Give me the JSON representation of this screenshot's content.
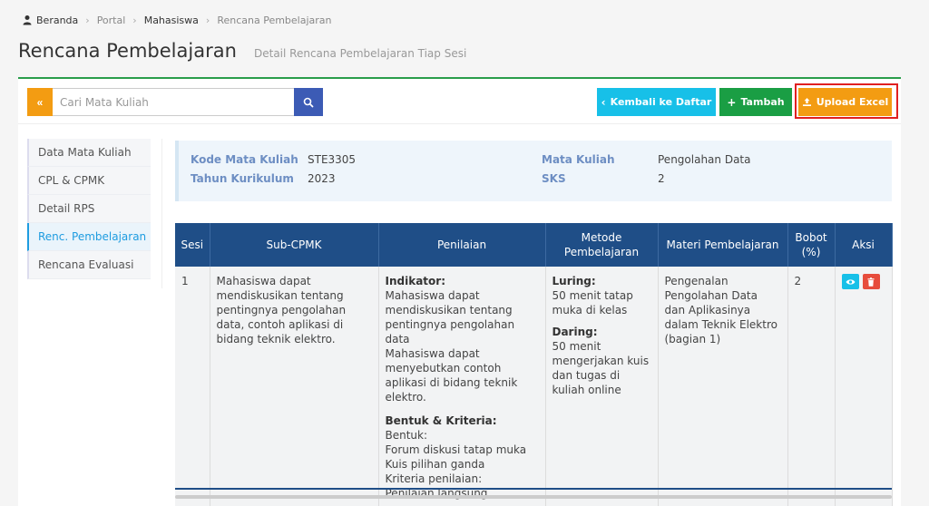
{
  "breadcrumb": {
    "items": [
      "Beranda",
      "Portal",
      "Mahasiswa",
      "Rencana Pembelajaran"
    ]
  },
  "page": {
    "title": "Rencana Pembelajaran",
    "subtitle": "Detail Rencana Pembelajaran Tiap Sesi"
  },
  "toolbar": {
    "toggle_label": "«",
    "search_placeholder": "Cari Mata Kuliah",
    "back_label": "Kembali ke Daftar",
    "add_label": "Tambah",
    "upload_label": "Upload Excel"
  },
  "sidebar": {
    "items": [
      {
        "label": "Data Mata Kuliah"
      },
      {
        "label": "CPL & CPMK"
      },
      {
        "label": "Detail RPS"
      },
      {
        "label": "Renc. Pembelajaran"
      },
      {
        "label": "Rencana Evaluasi"
      }
    ]
  },
  "info": {
    "kode_label": "Kode Mata Kuliah",
    "kode_value": "STE3305",
    "tahun_label": "Tahun Kurikulum",
    "tahun_value": "2023",
    "matkul_label": "Mata Kuliah",
    "matkul_value": "Pengolahan Data",
    "sks_label": "SKS",
    "sks_value": "2"
  },
  "table": {
    "headers": {
      "sesi": "Sesi",
      "sub_cpmk": "Sub-CPMK",
      "penilaian": "Penilaian",
      "metode_1": "Metode",
      "metode_2": "Pembelajaran",
      "materi": "Materi Pembelajaran",
      "bobot_1": "Bobot",
      "bobot_2": "(%)",
      "aksi": "Aksi"
    },
    "rows": [
      {
        "sesi": "1",
        "sub_cpmk": "Mahasiswa dapat mendiskusikan tentang pentingnya pengolahan data, contoh aplikasi di bidang teknik elektro.",
        "indikator_label": "Indikator:",
        "indikator_1": "Mahasiswa dapat mendiskusikan tentang pentingnya pengolahan data",
        "indikator_2": "Mahasiswa dapat menyebutkan contoh aplikasi di bidang teknik elektro.",
        "bentuk_label": "Bentuk & Kriteria:",
        "bentuk_title": "Bentuk:",
        "bentuk_1": "Forum diskusi tatap muka",
        "bentuk_2": "Kuis pilihan ganda",
        "kriteria_title": "Kriteria penilaian:",
        "kriteria_1": "Penilaian langsung",
        "luring_label": "Luring:",
        "luring_text": "50 menit tatap muka di kelas",
        "daring_label": "Daring:",
        "daring_text": "50 menit mengerjakan kuis dan tugas di kuliah online",
        "materi": "Pengenalan Pengolahan Data dan Aplikasinya dalam Teknik Elektro (bagian 1)",
        "bobot": "2"
      }
    ]
  },
  "colors": {
    "accent_green": "#2a9d4a",
    "header_blue": "#1f4e87",
    "orange": "#f39c12",
    "cyan": "#17c0e8",
    "red": "#e74c3c",
    "highlight_red": "#e02020"
  },
  "icons": [
    "user-icon",
    "search-icon",
    "chevron-left-icon",
    "plus-icon",
    "upload-icon",
    "eye-icon",
    "trash-icon"
  ]
}
